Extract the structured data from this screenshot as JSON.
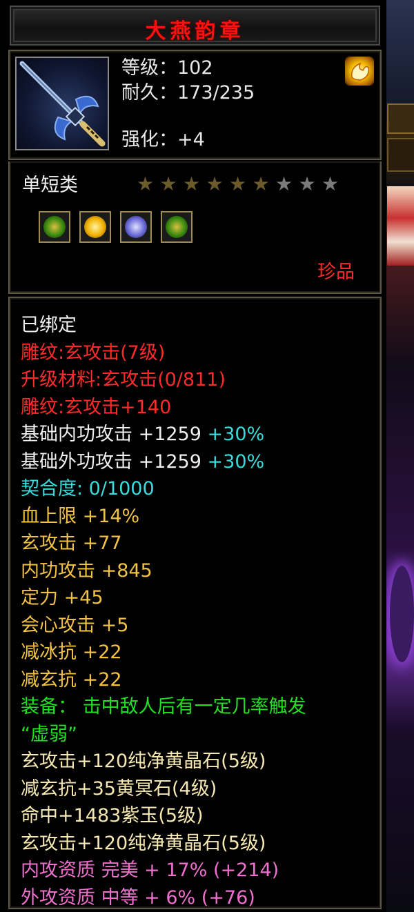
{
  "item": {
    "name": "大燕韵章",
    "level_text": "等级：102",
    "durability_text": "耐久：173/235",
    "enhance_text": "强化：+4",
    "category": "单短类",
    "rarity": "珍品",
    "stars_total": 9,
    "stars_filled": 6
  },
  "gems": [
    {
      "name": "green-gem-icon",
      "color": "#3a8a10"
    },
    {
      "name": "yellow-gem-icon",
      "color": "#f0b000"
    },
    {
      "name": "purple-gem-icon",
      "color": "#6a6ad8"
    },
    {
      "name": "green-gem-icon",
      "color": "#3a8a10"
    }
  ],
  "attributes": {
    "bound": "已绑定",
    "carving_level": "雕纹:玄攻击(7级)",
    "upgrade_material": "升级材料:玄攻击(0/811)",
    "carving_bonus": "雕纹:玄攻击+140",
    "base_inner": {
      "label": "基础内功攻击 +1259",
      "pct": "+30%"
    },
    "base_outer": {
      "label": "基础外功攻击 +1259",
      "pct": "+30%"
    },
    "affinity": "契合度: 0/1000",
    "bonuses": [
      "血上限 +14%",
      "玄攻击 +77",
      "内功攻击 +845",
      "定力 +45",
      "会心攻击 +5",
      "减冰抗 +22",
      "减玄抗 +22"
    ],
    "equip_effect_line1": "装备： 击中敌人后有一定几率触发",
    "equip_effect_line2": "“虚弱”",
    "gem_lines": [
      "玄攻击+120纯净黄晶石(5级)",
      "减玄抗+35黄冥石(4级)",
      "命中+1483紫玉(5级)",
      "玄攻击+120纯净黄晶石(5级)"
    ],
    "inner_quality": "内攻资质 完美 + 17% (+214)",
    "outer_quality": "外攻资质 中等 + 6% (+76)"
  },
  "colors": {
    "title": "#ff1010",
    "cyan": "#38dcdc",
    "red": "#ff2a2a",
    "gold": "#f2c244",
    "green": "#22e022",
    "pink": "#f070d0",
    "star_filled": "#6b5a2a",
    "star_empty": "#7a7a7a"
  }
}
